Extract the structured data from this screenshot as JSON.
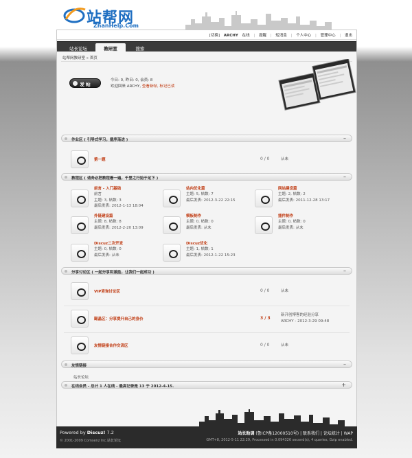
{
  "logo": {
    "text": "站帮网",
    "sub": "ZhanHelp.Com"
  },
  "toplinks": {
    "switch": "[切换]",
    "user": "ARCHY",
    "status": "在线",
    "items": [
      "提醒",
      "短消息",
      "个人中心",
      "管理中心",
      "退出"
    ]
  },
  "nav": {
    "tabs": [
      "站长论坛",
      "教研室",
      "搜索"
    ]
  },
  "breadcrumb": "站帮网教研室 » 首页",
  "hero": {
    "post_button": "发 帖",
    "stats": "今日: 0, 昨日: 0, 会员: 8",
    "welcome_prefix": "欢迎回来 ARCHY,",
    "welcome_links": "查看新帖, 标记已读"
  },
  "sections": [
    {
      "title": "作业区 ( 引导式学习，循序渐进 )"
    },
    {
      "title": "教程区 ( 请务必把教程看一遍，千里之行始于足下 )"
    },
    {
      "title": "分享讨论区 ( 一起分享和激励，让我们一起成功 )"
    },
    {
      "title": "友情链接"
    },
    {
      "title": "在线会员 - 总计 1 人在线 - 最高记录是 13 于 2012-4-15."
    }
  ],
  "homework": [
    {
      "name": "第一题",
      "count": "0 / 0",
      "last": "从未"
    }
  ],
  "tutorials": [
    {
      "name": "前言 - 入门基础",
      "desc": "前言",
      "meta": "主题: 3, 帖数: 3",
      "last": "最后发表: 2012-1-13 18:04"
    },
    {
      "name": "站内优化篇",
      "desc": "",
      "meta": "主题: 5, 帖数: 7",
      "last": "最后发表: 2012-3-22 22:15"
    },
    {
      "name": "网站建设篇",
      "desc": "",
      "meta": "主题: 2, 帖数: 2",
      "last": "最后发表: 2011-12-28 13:17"
    },
    {
      "name": "外链建设篇",
      "desc": "",
      "meta": "主题: 8, 帖数: 8",
      "last": "最后发表: 2012-2-20 13:09"
    },
    {
      "name": "模板制作",
      "desc": "",
      "meta": "主题: 0, 帖数: 0",
      "last": "最后发表: 从未"
    },
    {
      "name": "插件制作",
      "desc": "",
      "meta": "主题: 0, 帖数: 0",
      "last": "最后发表: 从未"
    },
    {
      "name": "Discuz二次开发",
      "desc": "",
      "meta": "主题: 0, 帖数: 0",
      "last": "最后发表: 从未"
    },
    {
      "name": "Discuz优化",
      "desc": "",
      "meta": "主题: 1, 帖数: 1",
      "last": "最后发表: 2012-1-22 15:23"
    }
  ],
  "discuss": [
    {
      "name": "VIP咨询讨论区",
      "count": "0 / 0",
      "last1": "从未",
      "last2": ""
    },
    {
      "name": "踢晶区：分享提升自己的身价",
      "count": "3 / 3",
      "last1": "新开创博客的经验分享",
      "last2": "ARCHY - 2012-3-29 09:48"
    },
    {
      "name": "友情链接合作交流区",
      "count": "0 / 0",
      "last1": "从未",
      "last2": ""
    }
  ],
  "friend_links": "站长论坛",
  "footer": {
    "powered_prefix": "Powered by",
    "powered_name": "Discuz!",
    "powered_ver": "7.2",
    "copyright": "© 2001-2009 Comsenz Inc.站长论坛",
    "right_name": "站长助调",
    "icp": "(鲁ICP备12000510号)",
    "links": "| 联系我们 | 论坛统计 | WAP",
    "gmt": "GMT+8, 2012-5-11 22:29, Processed in 0.094326 second(s), 4 queries, Gzip enabled."
  }
}
